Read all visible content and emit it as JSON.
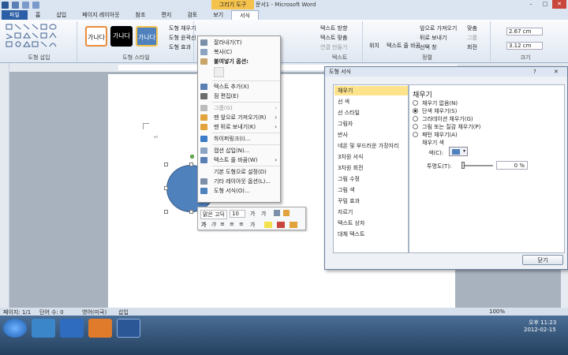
{
  "window": {
    "contextual_tab_group": "그리기 도구",
    "title": "문서1 - Microsoft Word",
    "minimize": "–",
    "maximize": "□",
    "close": "✕"
  },
  "tabs": [
    "파일",
    "홈",
    "삽입",
    "페이지 레이아웃",
    "참조",
    "편지",
    "검토",
    "보기",
    "서식"
  ],
  "ribbon": {
    "shape_insert_label": "도형 삽입",
    "shape_styles_label": "도형 스타일",
    "style_previews": [
      "가나다",
      "가나다",
      "가나다"
    ],
    "shape_fill": "도형 채우기",
    "shape_outline": "도형 윤곽선",
    "shape_effects": "도형 효과",
    "text_group_label": "텍스트",
    "text_direction": "텍스트 방향",
    "text_align": "텍스트 맞춤",
    "create_link": "연결 만들기",
    "position": "위치",
    "wrap_text": "텍스트 줄 바꿈",
    "bring_forward": "앞으로 가져오기",
    "send_backward": "뒤로 보내기",
    "selection_pane": "선택 창",
    "align": "맞춤",
    "group": "그룹",
    "rotate": "회전",
    "arrange_label": "정렬",
    "height": "2.67 cm",
    "width": "3.12 cm",
    "size_label": "크기"
  },
  "context_menu": {
    "items": [
      {
        "label": "잘라내기(T)",
        "icon": "scissors-icon",
        "disabled": false,
        "submenu": false
      },
      {
        "label": "복사(C)",
        "icon": "copy-icon",
        "disabled": false,
        "submenu": false
      },
      {
        "label": "붙여넣기 옵션:",
        "icon": "clipboard-icon",
        "disabled": false,
        "submenu": false
      },
      {
        "label": "텍스트 추가(X)",
        "icon": "text-box-icon",
        "disabled": false,
        "submenu": false
      },
      {
        "label": "점 편집(E)",
        "icon": "edit-points-icon",
        "disabled": false,
        "submenu": false
      },
      {
        "label": "그룹(G)",
        "icon": "group-icon",
        "disabled": true,
        "submenu": true
      },
      {
        "label": "맨 앞으로 가져오기(R)",
        "icon": "bring-front-icon",
        "disabled": false,
        "submenu": true
      },
      {
        "label": "맨 뒤로 보내기(K)",
        "icon": "send-back-icon",
        "disabled": false,
        "submenu": true
      },
      {
        "label": "하이퍼링크(I)...",
        "icon": "hyperlink-icon",
        "disabled": false,
        "submenu": false
      },
      {
        "label": "캡션 삽입(N)...",
        "icon": "caption-icon",
        "disabled": false,
        "submenu": false
      },
      {
        "label": "텍스트 줄 바꿈(W)",
        "icon": "wrap-icon",
        "disabled": false,
        "submenu": true
      },
      {
        "label": "기본 도형으로 설정(D)",
        "icon": "",
        "disabled": false,
        "submenu": false
      },
      {
        "label": "기타 레이아웃 옵션(L)...",
        "icon": "layout-icon",
        "disabled": false,
        "submenu": false
      },
      {
        "label": "도형 서식(O)...",
        "icon": "format-shape-icon",
        "disabled": false,
        "submenu": false
      }
    ]
  },
  "mini_toolbar": {
    "font": "맑은 고딕",
    "size": "10"
  },
  "dialog": {
    "title": "도형 서식",
    "help": "?",
    "close": "✕",
    "categories": [
      "채우기",
      "선 색",
      "선 스타일",
      "그림자",
      "반사",
      "네온 및 부드러운 가장자리",
      "3차원 서식",
      "3차원 회전",
      "그림 수정",
      "그림 색",
      "꾸밈 효과",
      "자르기",
      "텍스트 상자",
      "대체 텍스트"
    ],
    "selected_category": "채우기",
    "panel_heading": "채우기",
    "fill_options": [
      "채우기 없음(N)",
      "단색 채우기(S)",
      "그라데이션 채우기(G)",
      "그림 또는 질감 채우기(P)",
      "패턴 채우기(A)"
    ],
    "selected_fill": 1,
    "fill_color_label": "채우기 색",
    "color_label": "색(C):",
    "transparency_label": "투명도(T):",
    "transparency_value": "0 %",
    "transparency_level": 0,
    "close_button": "닫기"
  },
  "status": {
    "page": "페이지: 1/1",
    "words": "단어 수: 0",
    "language": "영어(미국)",
    "mode": "삽입",
    "zoom": "100%"
  },
  "taskbar": {
    "time": "오후 11:23",
    "date": "2012-02-15"
  }
}
